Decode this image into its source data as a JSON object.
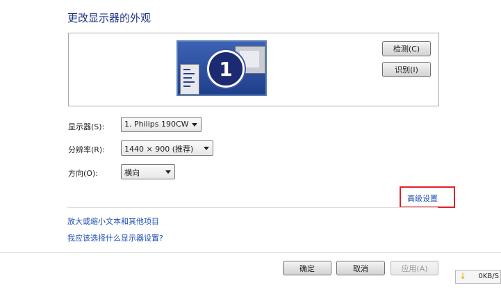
{
  "window": {
    "title": "更改显示器的外观"
  },
  "preview": {
    "monitor_number": "1"
  },
  "buttons": {
    "detect": "检测(C)",
    "identify": "识别(I)",
    "ok": "确定",
    "cancel": "取消",
    "apply": "应用(A)"
  },
  "settings": {
    "display": {
      "label": "显示器(S):",
      "value": "1. Philips 190CW"
    },
    "resolution": {
      "label": "分辨率(R):",
      "value": "1440 × 900 (推荐)"
    },
    "orientation": {
      "label": "方向(O):",
      "value": "横向"
    }
  },
  "links": {
    "advanced": "高级设置",
    "text_size": "放大或缩小文本和其他项目",
    "help": "我应该选择什么显示器设置?"
  },
  "tray": {
    "download_rate": "0KB/S"
  },
  "colors": {
    "highlight": "#e0202a",
    "link": "#1f4fb4",
    "title": "#1e3287"
  }
}
